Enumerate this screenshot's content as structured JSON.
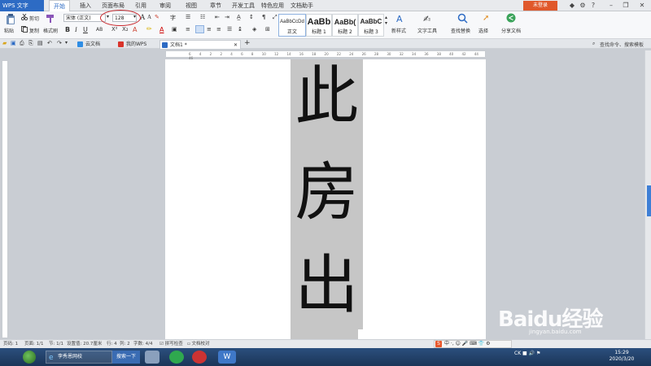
{
  "menubar": {
    "app_name": "WPS 文字",
    "tabs": [
      "开始",
      "插入",
      "页面布局",
      "引用",
      "审阅",
      "视图",
      "章节",
      "开发工具",
      "特色应用",
      "文档助手"
    ],
    "active_tab": "开始",
    "login_label": "未登录"
  },
  "ribbon": {
    "paste": "粘贴",
    "cut": "剪切",
    "copy": "复制",
    "format_painter": "格式刷",
    "font_name": "宋体 (正文)",
    "font_size": "128",
    "styles": [
      {
        "preview": "AaBbCcDd",
        "name": "正文"
      },
      {
        "preview": "AaBb",
        "name": "标题 1"
      },
      {
        "preview": "AaBb(",
        "name": "标题 2"
      },
      {
        "preview": "AaBbC",
        "name": "标题 3"
      }
    ],
    "new_style": "新样式",
    "text_tools": "文字工具",
    "find_replace": "查找替换",
    "select": "选择",
    "share_doc": "分享文档",
    "search_placeholder": "查找命令、搜索模板"
  },
  "doc_tabs": [
    {
      "label": "云文档",
      "color": "#2f8de4"
    },
    {
      "label": "我的WPS",
      "color": "#d9342b"
    },
    {
      "label": "文档1 *",
      "color": "#2d6bc4"
    }
  ],
  "ruler_numbers": "6 4 2 2 4 6 8 10 12 14 16 18 20 22 24 26 28 30 32 34 36 38 40 42 44 46",
  "document": {
    "characters": [
      "此",
      "房",
      "出"
    ]
  },
  "statusbar": {
    "page_no": "页码: 1",
    "pages": "页面: 1/1",
    "section": "节: 1/1",
    "position": "设置值: 20.7厘米",
    "row": "行: 4",
    "column": "列: 2",
    "word_count": "字数: 4/4",
    "spell_check": "拼写检查",
    "doc_proof": "文档校对"
  },
  "ime": {
    "logo": "S",
    "text": "中 ·, ☺ 🎤 ⌨ 👕 ⚙"
  },
  "taskbar": {
    "ie_label": "李秀恩网校",
    "search_label": "搜索一下",
    "tray_text": "CK ■ 🔊 ⚑",
    "time": "15:29",
    "date": "2020/3/20"
  },
  "watermark": {
    "text": "Baidu经验",
    "url": "jingyan.baidu.com"
  },
  "colors": {
    "brand_blue": "#2d6bc4",
    "login_orange": "#e0582b",
    "annotation_red": "#c8262b",
    "shade_gray": "#c6c6c6"
  }
}
